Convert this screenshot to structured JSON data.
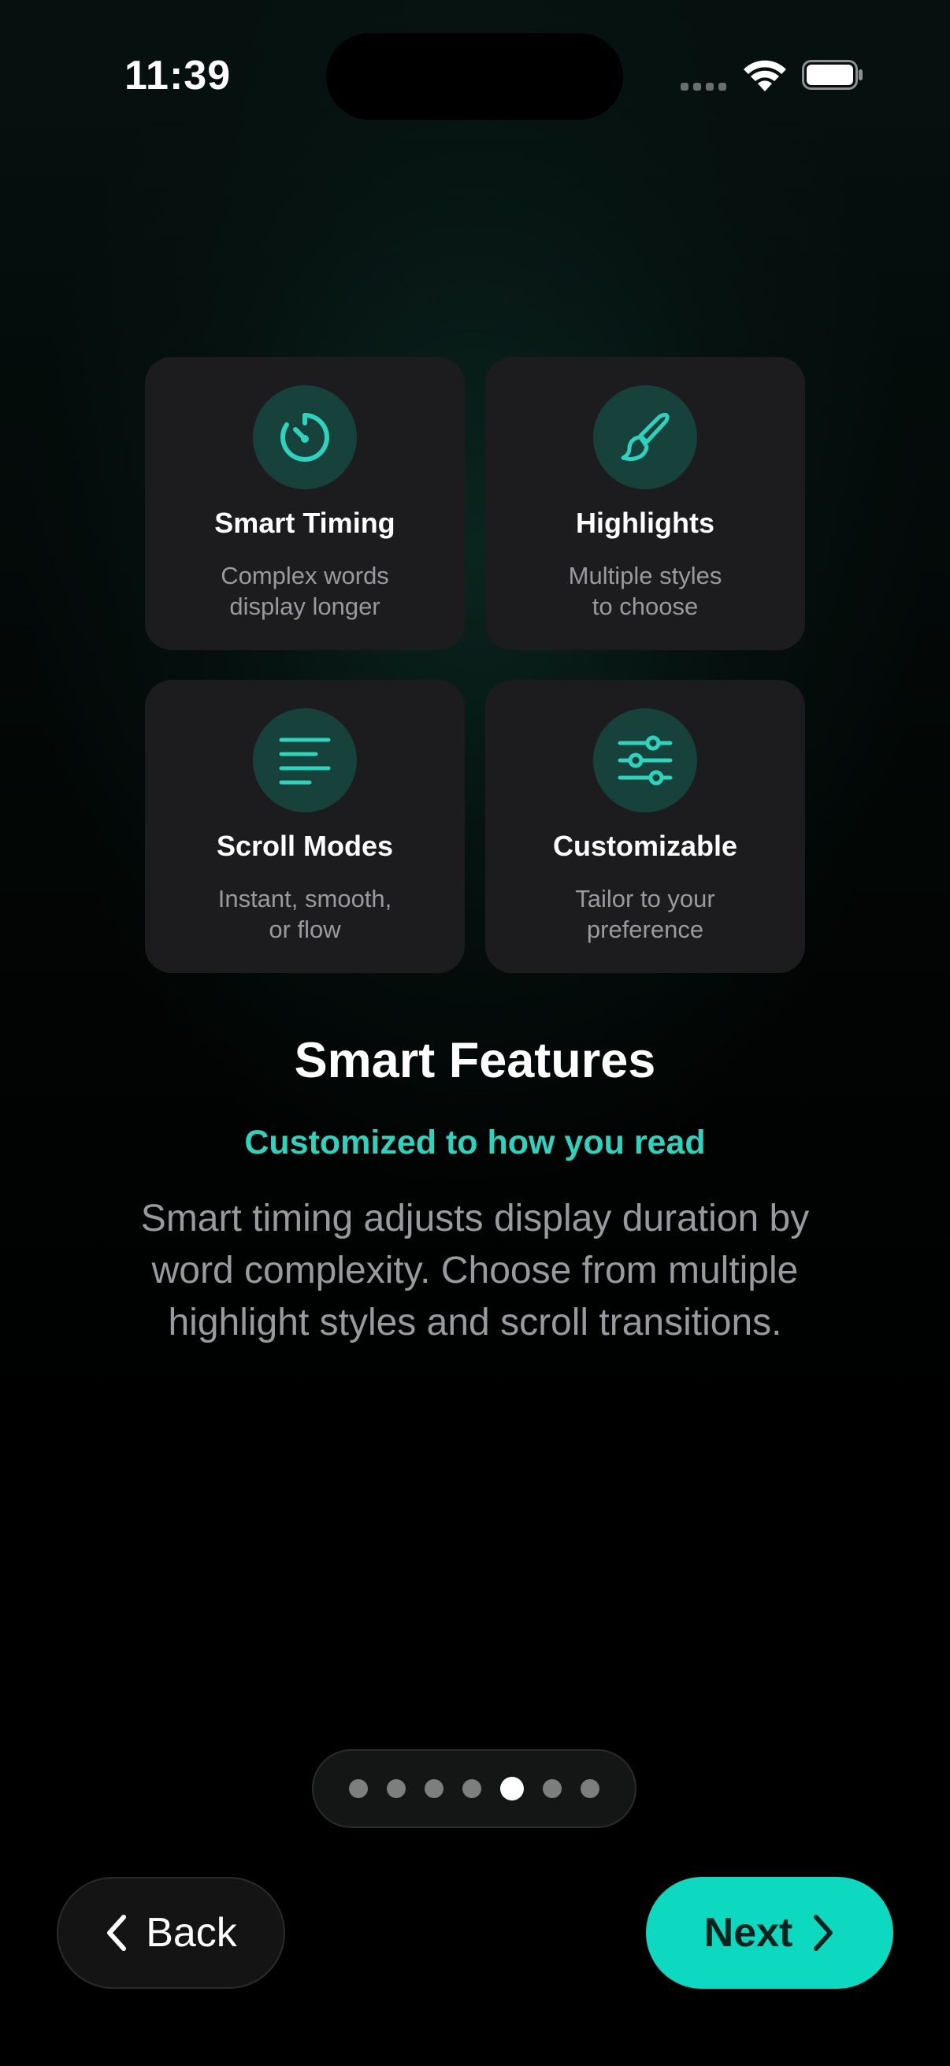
{
  "status_bar": {
    "time": "11:39"
  },
  "features": [
    {
      "icon": "timer-icon",
      "title": "Smart Timing",
      "desc_line1": "Complex words",
      "desc_line2": "display longer"
    },
    {
      "icon": "paintbrush-icon",
      "title": "Highlights",
      "desc_line1": "Multiple styles",
      "desc_line2": "to choose"
    },
    {
      "icon": "text-lines-icon",
      "title": "Scroll Modes",
      "desc_line1": "Instant, smooth,",
      "desc_line2": "or flow"
    },
    {
      "icon": "sliders-icon",
      "title": "Customizable",
      "desc_line1": "Tailor to your",
      "desc_line2": "preference"
    }
  ],
  "content": {
    "title": "Smart Features",
    "subtitle": "Customized to how you read",
    "body_line1": "Smart timing adjusts display duration by",
    "body_line2": "word complexity. Choose from multiple",
    "body_line3": "highlight styles and scroll transitions."
  },
  "pager": {
    "total_pages": 7,
    "current_page": 5
  },
  "nav": {
    "back_label": "Back",
    "next_label": "Next"
  },
  "colors": {
    "accent": "#2fd3bd",
    "next_button": "#0dd8c0",
    "card_bg": "#1c1c1e",
    "icon_circle": "#17413b"
  }
}
